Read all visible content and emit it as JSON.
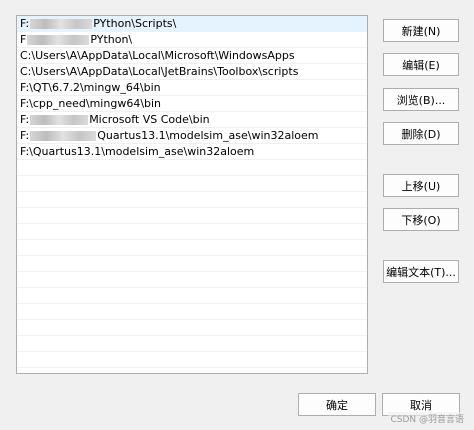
{
  "path_list": {
    "rows": [
      {
        "prefix": "F:",
        "redacted": true,
        "suffix": "PYthon\\Scripts\\",
        "selected": true
      },
      {
        "prefix": "F",
        "redacted": true,
        "suffix": "PYthon\\",
        "selected": false
      },
      {
        "prefix": "C:\\Users\\A\\AppData\\Local\\Microsoft\\WindowsApps",
        "redacted": false,
        "suffix": "",
        "selected": false
      },
      {
        "prefix": "C:\\Users\\A\\AppData\\Local\\JetBrains\\Toolbox\\scripts",
        "redacted": false,
        "suffix": "",
        "selected": false
      },
      {
        "prefix": "F:\\QT\\6.7.2\\mingw_64\\bin",
        "redacted": false,
        "suffix": "",
        "selected": false
      },
      {
        "prefix": "F:\\cpp_need\\mingw64\\bin",
        "redacted": false,
        "suffix": "",
        "selected": false
      },
      {
        "prefix": "F:",
        "redacted": true,
        "suffix": "Microsoft VS Code\\bin",
        "selected": false
      },
      {
        "prefix": "F:",
        "redacted": true,
        "suffix": "Quartus13.1\\modelsim_ase\\win32aloem",
        "selected": false
      },
      {
        "prefix": "F:\\Quartus13.1\\modelsim_ase\\win32aloem",
        "redacted": false,
        "suffix": "",
        "selected": false
      }
    ],
    "empty_row_count": 13
  },
  "buttons": {
    "new": "新建(N)",
    "edit": "编辑(E)",
    "browse": "浏览(B)...",
    "delete": "删除(D)",
    "move_up": "上移(U)",
    "move_down": "下移(O)",
    "edit_text": "编辑文本(T)...",
    "ok": "确定",
    "cancel": "取消"
  },
  "watermark": "CSDN @羽音言语",
  "colors": {
    "selected_row": "#e5f3ff",
    "dialog_bg": "#f0f0f0"
  }
}
